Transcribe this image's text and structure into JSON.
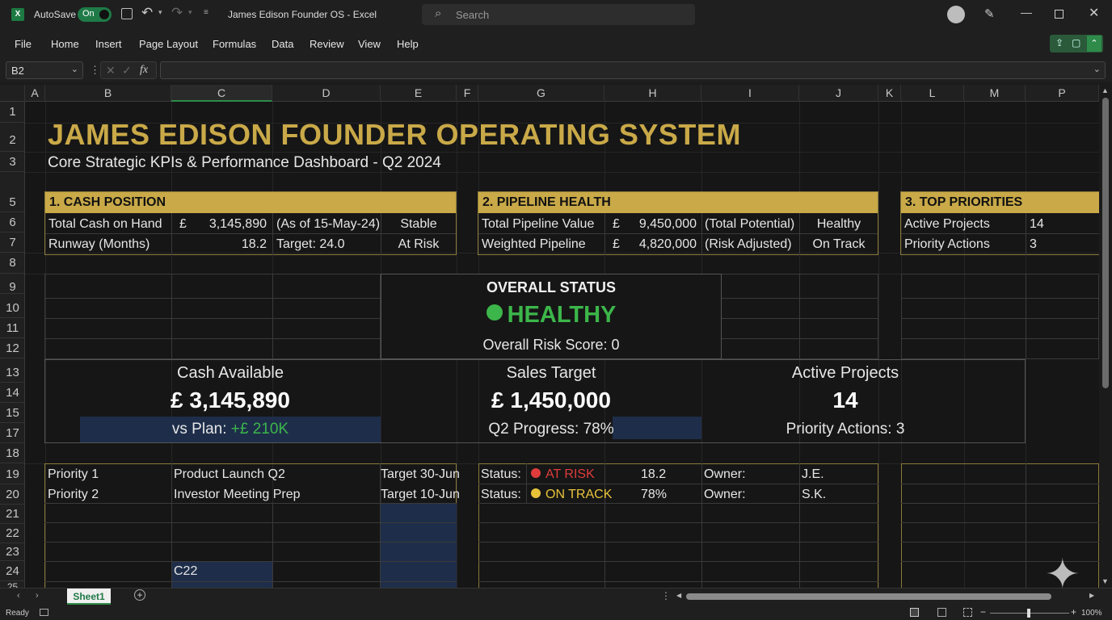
{
  "window": {
    "title": "James Edison Founder OS  -  Excel",
    "autosave_label": "AutoSave",
    "autosave_state": "On",
    "search_placeholder": "Search"
  },
  "menu": [
    "File",
    "Home",
    "Insert",
    "Page Layout",
    "Formulas",
    "Data",
    "Review",
    "View",
    "Help"
  ],
  "formula_bar": {
    "name_box": "B2",
    "formula": ""
  },
  "columns": [
    "A",
    "B",
    "C",
    "D",
    "E",
    "F",
    "G",
    "H",
    "I",
    "J",
    "K",
    "L",
    "M",
    "P"
  ],
  "rows": [
    "1",
    "2",
    "3",
    "5",
    "6",
    "7",
    "8",
    "9",
    "10",
    "11",
    "12",
    "13",
    "14",
    "15",
    "17",
    "18",
    "19",
    "20",
    "21",
    "22",
    "23",
    "24",
    "25"
  ],
  "dashboard": {
    "title": "JAMES EDISON FOUNDER OPERATING SYSTEM",
    "subtitle": "Core Strategic KPIs & Performance Dashboard - Q2 2024",
    "cash": {
      "header": "1. CASH POSITION",
      "r1": {
        "label": "Total Cash on Hand",
        "currency": "£",
        "value": "3,145,890",
        "note": "(As of 15-May-24)",
        "status": "Stable"
      },
      "r2": {
        "label": "Runway (Months)",
        "value": "18.2",
        "note": "Target: 24.0",
        "status": "At Risk"
      }
    },
    "pipeline": {
      "header": "2. PIPELINE HEALTH",
      "r1": {
        "label": "Total Pipeline Value",
        "currency": "£",
        "value": "9,450,000",
        "note": "(Total Potential)",
        "status": "Healthy"
      },
      "r2": {
        "label": "Weighted Pipeline",
        "currency": "£",
        "value": "4,820,000",
        "note": "(Risk Adjusted)",
        "status": "On Track"
      }
    },
    "priorities": {
      "header": "3. TOP PRIORITIES",
      "r1": {
        "label": "Active Projects",
        "value": "14"
      },
      "r2": {
        "label": "Priority Actions",
        "value": "3"
      }
    },
    "overall": {
      "heading": "OVERALL STATUS",
      "status": "HEALTHY",
      "risk": "Overall Risk Score: 0",
      "color": "#3cb64a"
    },
    "kpis": {
      "cash": {
        "label": "Cash Available",
        "value": "£ 3,145,890",
        "sub_prefix": "vs Plan: ",
        "sub_value": "+£ 210K"
      },
      "sales": {
        "label": "Sales Target",
        "value": "£ 1,450,000",
        "sub": "Q2 Progress: 78%"
      },
      "projects": {
        "label": "Active Projects",
        "value": "14",
        "sub": "Priority Actions: 3"
      }
    },
    "tasks": [
      {
        "priority": "Priority 1",
        "task": "Product Launch Q2",
        "target": "Target 30-Jun",
        "status_label": "Status:",
        "status": "AT RISK",
        "status_color": "#e03c3c",
        "value": "18.2",
        "owner_label": "Owner:",
        "owner": "J.E."
      },
      {
        "priority": "Priority 2",
        "task": "Investor Meeting Prep",
        "target": "Target 10-Jun",
        "status_label": "Status:",
        "status": "ON TRACK",
        "status_color": "#e8c33a",
        "value": "78%",
        "owner_label": "Owner:",
        "owner": "S.K."
      }
    ],
    "selected_cell_text": "C22"
  },
  "sheet_tab": "Sheet1",
  "status": {
    "ready": "Ready",
    "zoom": "100%"
  },
  "colors": {
    "gold": "#c9a948",
    "green": "#3cb64a",
    "navy": "#1e2e4a"
  }
}
